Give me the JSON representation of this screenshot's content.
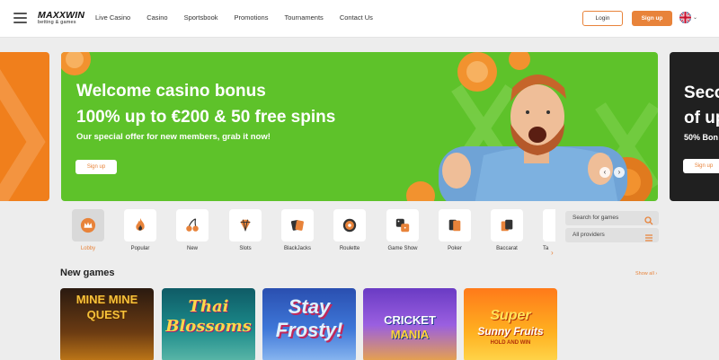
{
  "header": {
    "logo": {
      "name": "MAXXWIN",
      "tagline": "betting & games"
    },
    "nav": [
      "Live Casino",
      "Casino",
      "Sportsbook",
      "Promotions",
      "Tournaments",
      "Contact Us"
    ],
    "login_label": "Login",
    "signup_label": "Sign up"
  },
  "banners": {
    "main": {
      "title_line1": "Welcome casino bonus",
      "title_line2": "100% up to €200 & 50 free spins",
      "subtitle": "Our special offer for new members, grab it now!",
      "button": "Sign up",
      "prev_arrow": "‹",
      "next_arrow": "›"
    },
    "right_partial": {
      "title_line1": "Seco",
      "title_line2": "of up",
      "subtitle": "50% Bon",
      "button": "Sign up"
    }
  },
  "categories": [
    {
      "label": "Lobby",
      "icon": "crown-icon",
      "active": true
    },
    {
      "label": "Popular",
      "icon": "flame-icon",
      "active": false
    },
    {
      "label": "New",
      "icon": "cherries-icon",
      "active": false
    },
    {
      "label": "Slots",
      "icon": "diamond-icon",
      "active": false
    },
    {
      "label": "BlackJacks",
      "icon": "cards-icon",
      "active": false
    },
    {
      "label": "Roulette",
      "icon": "roulette-wheel-icon",
      "active": false
    },
    {
      "label": "Game Show",
      "icon": "dice-icon",
      "active": false
    },
    {
      "label": "Poker",
      "icon": "poker-cards-icon",
      "active": false
    },
    {
      "label": "Baccarat",
      "icon": "baccarat-cards-icon",
      "active": false
    },
    {
      "label": "Ta",
      "icon": "table-games-icon",
      "active": false
    }
  ],
  "filters": {
    "search_placeholder": "Search for games",
    "providers_label": "All providers"
  },
  "new_games": {
    "title": "New games",
    "show_all": "Show all ›",
    "games": [
      {
        "title": "MINE MINE QUEST",
        "line1": "MINE MINE",
        "line2": "QUEST"
      },
      {
        "title": "Thai Blossoms",
        "line1": "Thai",
        "line2": "Blossoms"
      },
      {
        "title": "Stay Frosty!",
        "line1": "Stay",
        "line2": "Frosty!"
      },
      {
        "title": "Cricket Mania",
        "line1": "CRICKET",
        "line2": "MANIA"
      },
      {
        "title": "Super Sunny Fruits Hold and Win",
        "line1": "Super",
        "line2": "Sunny Fruits",
        "line3": "HOLD AND WIN"
      }
    ]
  },
  "colors": {
    "accent": "#e8833a",
    "banner_green": "#5ec22a",
    "banner_orange": "#f07f1c",
    "banner_dark": "#202020",
    "page_bg": "#ededed"
  }
}
